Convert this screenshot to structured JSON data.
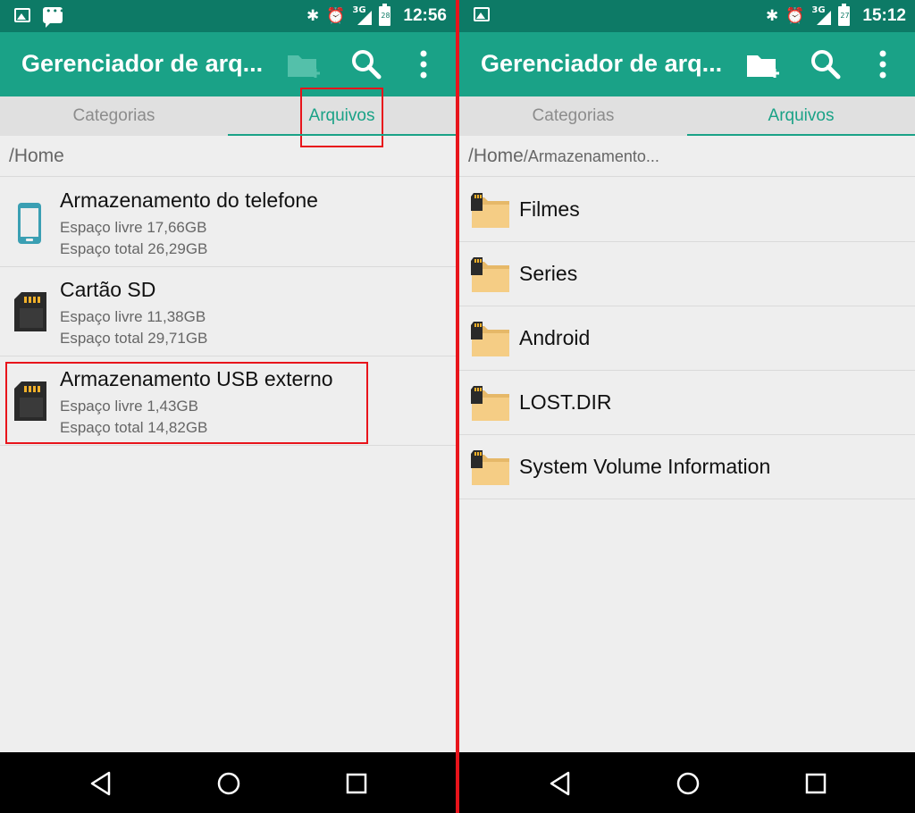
{
  "left": {
    "status": {
      "time": "12:56",
      "battery": "28",
      "network": "3G"
    },
    "app_title": "Gerenciador de arq...",
    "tabs": [
      {
        "label": "Categorias"
      },
      {
        "label": "Arquivos"
      }
    ],
    "breadcrumb": {
      "main": "/Home",
      "sub": ""
    },
    "storage": [
      {
        "name": "Armazenamento do telefone",
        "free": "Espaço livre 17,66GB",
        "total": "Espaço total 26,29GB",
        "icon": "phone-icon"
      },
      {
        "name": "Cartão SD",
        "free": "Espaço livre 11,38GB",
        "total": "Espaço total 29,71GB",
        "icon": "sd-card-icon"
      },
      {
        "name": "Armazenamento USB externo",
        "free": "Espaço livre 1,43GB",
        "total": "Espaço total 14,82GB",
        "icon": "sd-card-icon"
      }
    ]
  },
  "right": {
    "status": {
      "time": "15:12",
      "battery": "27",
      "network": "3G"
    },
    "app_title": "Gerenciador de arq...",
    "tabs": [
      {
        "label": "Categorias"
      },
      {
        "label": "Arquivos"
      }
    ],
    "breadcrumb": {
      "main": "/Home",
      "sub": "/Armazenamento..."
    },
    "folders": [
      {
        "name": "Filmes"
      },
      {
        "name": "Series"
      },
      {
        "name": "Android"
      },
      {
        "name": "LOST.DIR"
      },
      {
        "name": "System Volume Information"
      }
    ]
  },
  "colors": {
    "status_bar": "#0d7a66",
    "app_bar": "#1aa287",
    "accent": "#1aa287",
    "highlight": "#e8141b",
    "folder": "#f5cd85"
  }
}
